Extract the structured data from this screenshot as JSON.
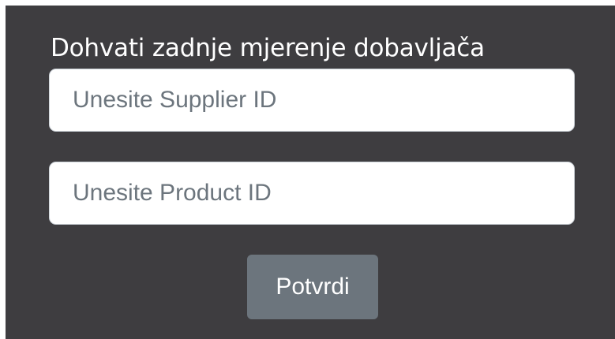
{
  "form": {
    "title": "Dohvati zadnje mjerenje dobavljača",
    "supplier_id": {
      "value": "",
      "placeholder": "Unesite Supplier ID"
    },
    "product_id": {
      "value": "",
      "placeholder": "Unesite Product ID"
    },
    "submit_label": "Potvrdi"
  },
  "colors": {
    "panel_background": "#3e3d40",
    "title_text": "#ffffff",
    "input_background": "#ffffff",
    "placeholder_text": "#6c757d",
    "button_background": "#6c757d",
    "button_text": "#ffffff"
  }
}
